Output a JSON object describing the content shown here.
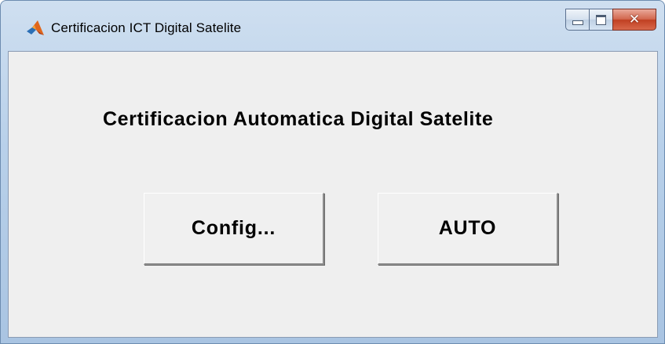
{
  "window": {
    "title": "Certificacion ICT Digital Satelite",
    "icon": "matlab-icon",
    "caption_buttons": [
      "minimize-icon",
      "maximize-icon",
      "close-icon"
    ]
  },
  "main": {
    "heading": "Certificacion Automatica Digital Satelite",
    "buttons": {
      "config_label": "Config...",
      "auto_label": "AUTO"
    }
  },
  "colors": {
    "client_background": "#efefef",
    "titlebar": "#b9d1ea",
    "close_button": "#c04022"
  }
}
